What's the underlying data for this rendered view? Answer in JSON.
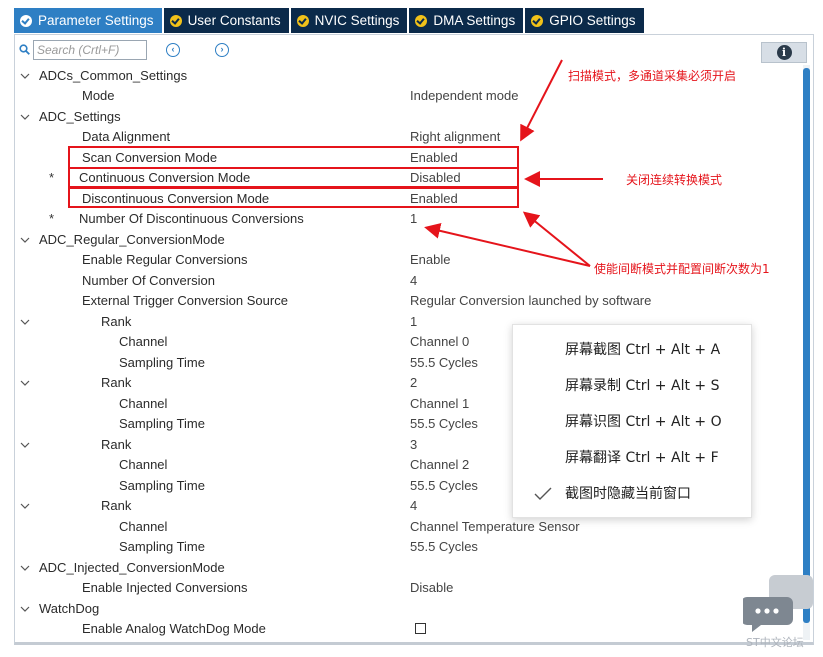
{
  "tabs": [
    {
      "label": "Parameter Settings",
      "active": true
    },
    {
      "label": "User Constants",
      "active": false
    },
    {
      "label": "NVIC Settings",
      "active": false
    },
    {
      "label": "DMA Settings",
      "active": false
    },
    {
      "label": "GPIO Settings",
      "active": false
    }
  ],
  "toolbar": {
    "search_placeholder": "Search (Crtl+F)",
    "prev_icon": "chevron-left-circle-icon",
    "next_icon": "chevron-right-circle-icon",
    "info_icon": "info-icon",
    "info_glyph": "i"
  },
  "tree": [
    {
      "label": "ADCs_Common_Settings",
      "value": ""
    },
    {
      "label": "Mode",
      "value": "Independent mode"
    },
    {
      "label": "ADC_Settings",
      "value": ""
    },
    {
      "label": "Data Alignment",
      "value": "Right alignment"
    },
    {
      "label": "Scan Conversion Mode",
      "value": "Enabled"
    },
    {
      "label": "Continuous Conversion Mode",
      "value": "Disabled",
      "star": "*"
    },
    {
      "label": "Discontinuous Conversion Mode",
      "value": "Enabled"
    },
    {
      "label": "Number Of Discontinuous Conversions",
      "value": "1",
      "star": "*"
    },
    {
      "label": "ADC_Regular_ConversionMode",
      "value": ""
    },
    {
      "label": "Enable Regular Conversions",
      "value": "Enable"
    },
    {
      "label": "Number Of Conversion",
      "value": "4"
    },
    {
      "label": "External Trigger Conversion Source",
      "value": "Regular Conversion launched by software"
    },
    {
      "label": "Rank",
      "value": "1"
    },
    {
      "label": "Channel",
      "value": "Channel 0"
    },
    {
      "label": "Sampling Time",
      "value": "55.5 Cycles"
    },
    {
      "label": "Rank",
      "value": "2"
    },
    {
      "label": "Channel",
      "value": "Channel 1"
    },
    {
      "label": "Sampling Time",
      "value": "55.5 Cycles"
    },
    {
      "label": "Rank",
      "value": "3"
    },
    {
      "label": "Channel",
      "value": "Channel 2"
    },
    {
      "label": "Sampling Time",
      "value": "55.5 Cycles"
    },
    {
      "label": "Rank",
      "value": "4"
    },
    {
      "label": "Channel",
      "value": "Channel Temperature Sensor"
    },
    {
      "label": "Sampling Time",
      "value": "55.5 Cycles"
    },
    {
      "label": "ADC_Injected_ConversionMode",
      "value": ""
    },
    {
      "label": "Enable Injected Conversions",
      "value": "Disable"
    },
    {
      "label": "WatchDog",
      "value": ""
    },
    {
      "label": "Enable Analog WatchDog Mode",
      "value": ""
    }
  ],
  "annotations": {
    "scan_note": "扫描模式，多通道采集必须开启",
    "continuous_note": "关闭连续转换模式",
    "discontinuous_note": "使能间断模式并配置间断次数为1"
  },
  "context_menu": {
    "items": [
      {
        "label": "屏幕截图 Ctrl + Alt + A"
      },
      {
        "label": "屏幕录制 Ctrl + Alt + S"
      },
      {
        "label": "屏幕识图 Ctrl + Alt + O"
      },
      {
        "label": "屏幕翻译 Ctrl + Alt + F"
      },
      {
        "label": "截图时隐藏当前窗口",
        "checked": true
      }
    ]
  },
  "watermark": {
    "icon": "chat-bubble-icon",
    "text": "ST中文论坛"
  },
  "colors": {
    "tab_active": "#2e7fc4",
    "tab_inactive": "#0b2a4a",
    "tab_check": "#f2c219",
    "annotation_red": "#e5141b",
    "scrollbar": "#2e7fc4"
  }
}
